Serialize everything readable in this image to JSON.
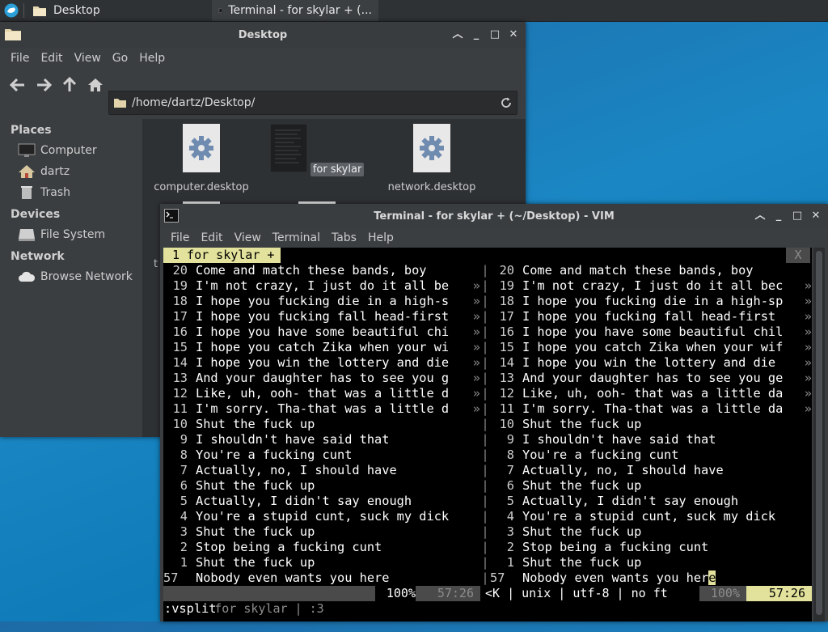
{
  "panel": {
    "tasks": [
      {
        "label": "Desktop"
      },
      {
        "label": "Terminal - for skylar + (..."
      }
    ]
  },
  "file_manager": {
    "title": "Desktop",
    "menu": [
      "File",
      "Edit",
      "View",
      "Go",
      "Help"
    ],
    "path": "/home/dartz/Desktop/",
    "sidebar": {
      "places_heading": "Places",
      "places": [
        "Computer",
        "dartz",
        "Trash"
      ],
      "devices_heading": "Devices",
      "devices": [
        "File System"
      ],
      "network_heading": "Network",
      "network": [
        "Browse Network"
      ]
    },
    "files": [
      {
        "name": "computer.desktop"
      },
      {
        "name": "for skylar"
      },
      {
        "name": "network.desktop"
      }
    ],
    "partial_label_t": "t",
    "partial_label_quote": "“"
  },
  "terminal": {
    "title": "Terminal - for skylar + (~/Desktop) - VIM",
    "menu": [
      "File",
      "Edit",
      "View",
      "Terminal",
      "Tabs",
      "Help"
    ],
    "vim": {
      "tab_label": "1 for skylar +",
      "tab_close": "X",
      "left_lines": [
        {
          "n": "20",
          "t": "Come and match these bands, boy",
          "more": ""
        },
        {
          "n": "19",
          "t": "I'm not crazy, I just do it all be",
          "more": "»"
        },
        {
          "n": "18",
          "t": "I hope you fucking die in a high-s",
          "more": "»"
        },
        {
          "n": "17",
          "t": "I hope you fucking fall head-first",
          "more": "»"
        },
        {
          "n": "16",
          "t": "I hope you have some beautiful chi",
          "more": "»"
        },
        {
          "n": "15",
          "t": "I hope you catch Zika when your wi",
          "more": "»"
        },
        {
          "n": "14",
          "t": "I hope you win the lottery and die",
          "more": "»"
        },
        {
          "n": "13",
          "t": "And your daughter has to see you g",
          "more": "»"
        },
        {
          "n": "12",
          "t": "Like, uh, ooh- that was a little d",
          "more": "»"
        },
        {
          "n": "11",
          "t": "I'm sorry. Tha-that was a little d",
          "more": "»"
        },
        {
          "n": "10",
          "t": "Shut the fuck up",
          "more": ""
        },
        {
          "n": "9",
          "t": "I shouldn't have said that",
          "more": ""
        },
        {
          "n": "8",
          "t": "You're a fucking cunt",
          "more": ""
        },
        {
          "n": "7",
          "t": "Actually, no, I should have",
          "more": ""
        },
        {
          "n": "6",
          "t": "Shut the fuck up",
          "more": ""
        },
        {
          "n": "5",
          "t": "Actually, I didn't say enough",
          "more": ""
        },
        {
          "n": "4",
          "t": "You're a stupid cunt, suck my dick",
          "more": ""
        },
        {
          "n": "3",
          "t": "Shut the fuck up",
          "more": ""
        },
        {
          "n": "2",
          "t": "Stop being a fucking cunt",
          "more": ""
        },
        {
          "n": "1",
          "t": "Shut the fuck up",
          "more": ""
        },
        {
          "n": "57",
          "t": "Nobody even wants you here",
          "more": ""
        }
      ],
      "right_lines": [
        {
          "n": "20",
          "t": "Come and match these bands, boy",
          "more": ""
        },
        {
          "n": "19",
          "t": "I'm not crazy, I just do it all bec",
          "more": "»"
        },
        {
          "n": "18",
          "t": "I hope you fucking die in a high-sp",
          "more": "»"
        },
        {
          "n": "17",
          "t": "I hope you fucking fall head-first ",
          "more": "»"
        },
        {
          "n": "16",
          "t": "I hope you have some beautiful chil",
          "more": "»"
        },
        {
          "n": "15",
          "t": "I hope you catch Zika when your wif",
          "more": "»"
        },
        {
          "n": "14",
          "t": "I hope you win the lottery and die ",
          "more": "»"
        },
        {
          "n": "13",
          "t": "And your daughter has to see you ge",
          "more": "»"
        },
        {
          "n": "12",
          "t": "Like, uh, ooh- that was a little da",
          "more": "»"
        },
        {
          "n": "11",
          "t": "I'm sorry. Tha-that was a little da",
          "more": "»"
        },
        {
          "n": "10",
          "t": "Shut the fuck up",
          "more": ""
        },
        {
          "n": "9",
          "t": "I shouldn't have said that",
          "more": ""
        },
        {
          "n": "8",
          "t": "You're a fucking cunt",
          "more": ""
        },
        {
          "n": "7",
          "t": "Actually, no, I should have",
          "more": ""
        },
        {
          "n": "6",
          "t": "Shut the fuck up",
          "more": ""
        },
        {
          "n": "5",
          "t": "Actually, I didn't say enough",
          "more": ""
        },
        {
          "n": "4",
          "t": "You're a stupid cunt, suck my dick",
          "more": ""
        },
        {
          "n": "3",
          "t": "Shut the fuck up",
          "more": ""
        },
        {
          "n": "2",
          "t": "Stop being a fucking cunt",
          "more": ""
        },
        {
          "n": "1",
          "t": "Shut the fuck up",
          "more": ""
        },
        {
          "n": "57",
          "t": "Nobody even wants you her",
          "more": ""
        }
      ],
      "cursor_char": "e",
      "status_left": {
        "name": " for skylar | :3",
        "pct": "100%",
        "pos": "57:26"
      },
      "status_right": {
        "info": "<K | unix | utf-8 | no ft",
        "pct": "100%",
        "pos": "57:26"
      },
      "command_line": ":vsplit"
    }
  },
  "colors": {
    "vim_highlight": "#e2e29c",
    "inactive_status": "#4a4a4a",
    "window_bg": "#3b3e41"
  }
}
